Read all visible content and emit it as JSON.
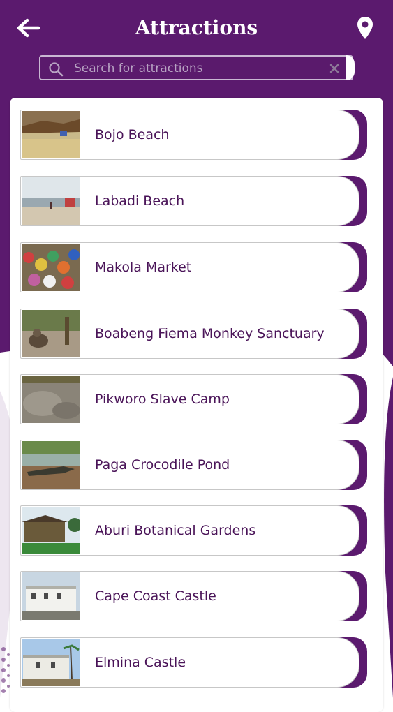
{
  "header": {
    "title": "Attractions",
    "back_icon": "arrow-left-icon",
    "location_icon": "map-pin-icon"
  },
  "search": {
    "placeholder": "Search for attractions",
    "value": ""
  },
  "colors": {
    "primary": "#5b1a6e",
    "text": "#4a1458",
    "white": "#ffffff"
  },
  "attractions": [
    {
      "name": "Bojo Beach"
    },
    {
      "name": "Labadi Beach"
    },
    {
      "name": "Makola Market"
    },
    {
      "name": "Boabeng Fiema Monkey Sanctuary"
    },
    {
      "name": "Pikworo Slave Camp"
    },
    {
      "name": "Paga Crocodile Pond"
    },
    {
      "name": "Aburi Botanical Gardens"
    },
    {
      "name": "Cape Coast Castle"
    },
    {
      "name": "Elmina Castle"
    }
  ]
}
